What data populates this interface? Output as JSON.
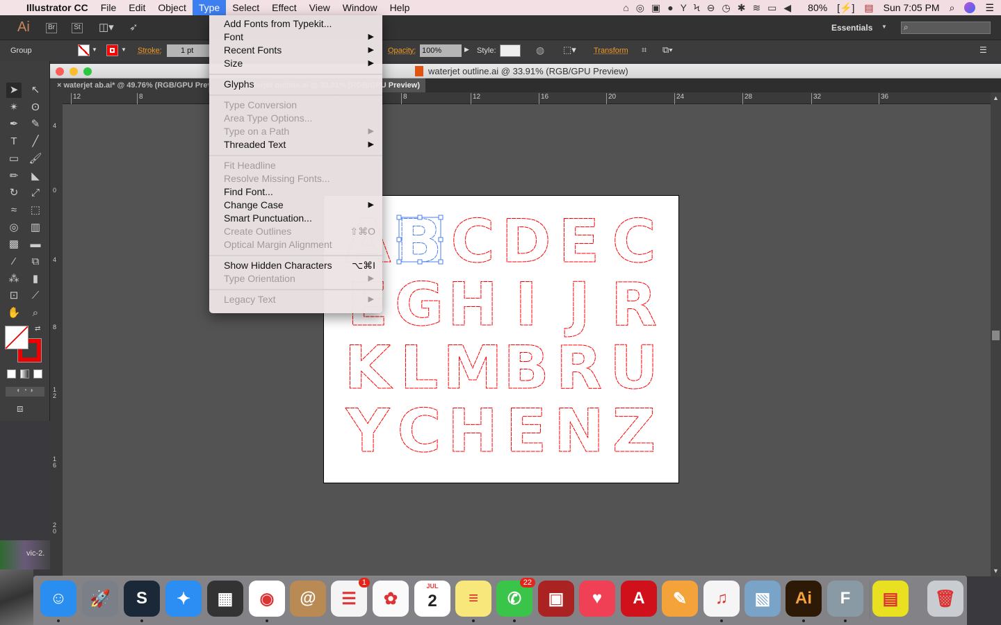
{
  "menubar": {
    "app": "Illustrator CC",
    "items": [
      "File",
      "Edit",
      "Object",
      "Type",
      "Select",
      "Effect",
      "View",
      "Window",
      "Help"
    ],
    "active": "Type",
    "battery": "80%",
    "clock": "Sun 7:05 PM"
  },
  "appbar": {
    "logo": "Ai",
    "bridge": "Br",
    "stock": "St",
    "workspace": "Essentials"
  },
  "control": {
    "selection": "Group",
    "stroke_label": "Stroke:",
    "stroke_value": "1 pt",
    "opacity_label": "Opacity:",
    "opacity_value": "100%",
    "style_label": "Style:",
    "transform_label": "Transform",
    "fill_color": "#ffffff",
    "stroke_color": "#ff0000"
  },
  "document": {
    "window_title": "waterjet outline.ai @ 33.91% (RGB/GPU Preview)",
    "tabs": [
      "waterjet ab.ai* @ 49.76% (RGB/GPU Preview)",
      "waterjet outline.ai @ 33.91% (RGB/GPU Preview)"
    ],
    "hruler": [
      "12",
      "8",
      "4",
      "8",
      "12",
      "16",
      "20",
      "24",
      "28",
      "32",
      "36"
    ],
    "vruler": [
      "4",
      "0",
      "4",
      "8",
      "12",
      "16",
      "20"
    ]
  },
  "artwork": {
    "rows": [
      [
        "A",
        "B",
        "C",
        "D",
        "E",
        "C"
      ],
      [
        "E",
        "G",
        "H",
        "I",
        "J",
        "R"
      ],
      [
        "K",
        "L",
        "M",
        "B",
        "R",
        "U"
      ],
      [
        "Y",
        "C",
        "H",
        "E",
        "N",
        "Z"
      ]
    ],
    "outline_color": "#ff0000",
    "selection_color": "#4a7cf0"
  },
  "type_menu": {
    "groups": [
      [
        {
          "label": "Add Fonts from Typekit...",
          "enabled": true
        },
        {
          "label": "Font",
          "enabled": true,
          "submenu": true
        },
        {
          "label": "Recent Fonts",
          "enabled": true,
          "submenu": true
        },
        {
          "label": "Size",
          "enabled": true,
          "submenu": true
        }
      ],
      [
        {
          "label": "Glyphs",
          "enabled": true
        }
      ],
      [
        {
          "label": "Type Conversion",
          "enabled": false
        },
        {
          "label": "Area Type Options...",
          "enabled": false
        },
        {
          "label": "Type on a Path",
          "enabled": false,
          "submenu": true
        },
        {
          "label": "Threaded Text",
          "enabled": true,
          "submenu": true
        }
      ],
      [
        {
          "label": "Fit Headline",
          "enabled": false
        },
        {
          "label": "Resolve Missing Fonts...",
          "enabled": false
        },
        {
          "label": "Find Font...",
          "enabled": true
        },
        {
          "label": "Change Case",
          "enabled": true,
          "submenu": true
        },
        {
          "label": "Smart Punctuation...",
          "enabled": true
        },
        {
          "label": "Create Outlines",
          "enabled": false,
          "shortcut": "⇧⌘O"
        },
        {
          "label": "Optical Margin Alignment",
          "enabled": false
        }
      ],
      [
        {
          "label": "Show Hidden Characters",
          "enabled": true,
          "shortcut": "⌥⌘I"
        },
        {
          "label": "Type Orientation",
          "enabled": false,
          "submenu": true
        }
      ],
      [
        {
          "label": "Legacy Text",
          "enabled": false,
          "submenu": true
        }
      ]
    ]
  },
  "desktop": {
    "file_label": "vic-2."
  },
  "dock": [
    {
      "name": "finder",
      "color": "#2a8ef0",
      "glyph": "☺"
    },
    {
      "name": "launchpad",
      "color": "#7a7f88",
      "glyph": "🚀"
    },
    {
      "name": "steam",
      "color": "#1b2838",
      "glyph": "S"
    },
    {
      "name": "safari",
      "color": "#2c8df2",
      "glyph": "✦"
    },
    {
      "name": "app",
      "color": "#333",
      "glyph": "▦"
    },
    {
      "name": "chrome",
      "color": "#ffffff",
      "glyph": "◉"
    },
    {
      "name": "contacts",
      "color": "#b98a53",
      "glyph": "@"
    },
    {
      "name": "reminders",
      "color": "#f4f4f4",
      "glyph": "☰",
      "badge": "1"
    },
    {
      "name": "photos",
      "color": "#fafafa",
      "glyph": "✿"
    },
    {
      "name": "calendar",
      "color": "#ffffff",
      "glyph": "2",
      "sub": "JUL"
    },
    {
      "name": "notes",
      "color": "#f8e77a",
      "glyph": "≡"
    },
    {
      "name": "facetime",
      "color": "#3bc44a",
      "glyph": "✆",
      "badge": "22"
    },
    {
      "name": "photo-booth",
      "color": "#a22",
      "glyph": "▣"
    },
    {
      "name": "pocket",
      "color": "#ef4056",
      "glyph": "♥"
    },
    {
      "name": "autocad",
      "color": "#d0101a",
      "glyph": "A"
    },
    {
      "name": "pages",
      "color": "#f3a33a",
      "glyph": "✎"
    },
    {
      "name": "itunes",
      "color": "#f5f5f5",
      "glyph": "♫"
    },
    {
      "name": "preview",
      "color": "#7aa3c8",
      "glyph": "▧"
    },
    {
      "name": "illustrator",
      "color": "#2d1a06",
      "glyph": "Ai"
    },
    {
      "name": "fontforge",
      "color": "#8a9aa5",
      "glyph": "F"
    },
    {
      "name": "document",
      "color": "#e8e020",
      "glyph": "▤"
    },
    {
      "name": "trash",
      "color": "#c9ccd0",
      "glyph": "🗑"
    }
  ]
}
